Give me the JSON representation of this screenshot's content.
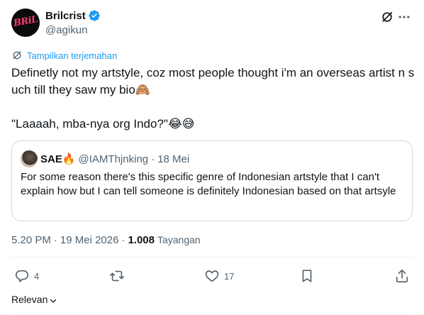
{
  "author": {
    "display_name": "Brilcrist",
    "handle": "@agikun",
    "avatar_logo_text": "BRiL",
    "verified": true
  },
  "translate_label": "Tampilkan terjemahan",
  "tweet": {
    "text": "Definetly not my artstyle, coz most people thought i'm an overseas artist n such till they saw my bio🙈\n\n\"Laaaah, mba-nya org Indo?\"😂😅"
  },
  "quote": {
    "name": "SAE🔥",
    "handle": "@IAMThjnking",
    "dot": "·",
    "date": "18 Mei",
    "text": "For some reason there's this specific genre of Indonesian artstyle that I can't explain how but I can tell someone is definitely Indonesian based on that artsyle"
  },
  "meta": {
    "time": "5.20 PM",
    "date": "19 Mei 2026",
    "views": "1.008",
    "views_label": "Tayangan",
    "sep": "·"
  },
  "actions": {
    "reply_count": "4",
    "like_count": "17"
  },
  "relevance_label": "Relevan",
  "colors": {
    "accent": "#1d9bf0",
    "text": "#0f1419",
    "muted": "#536471",
    "border": "#cfd9de"
  }
}
